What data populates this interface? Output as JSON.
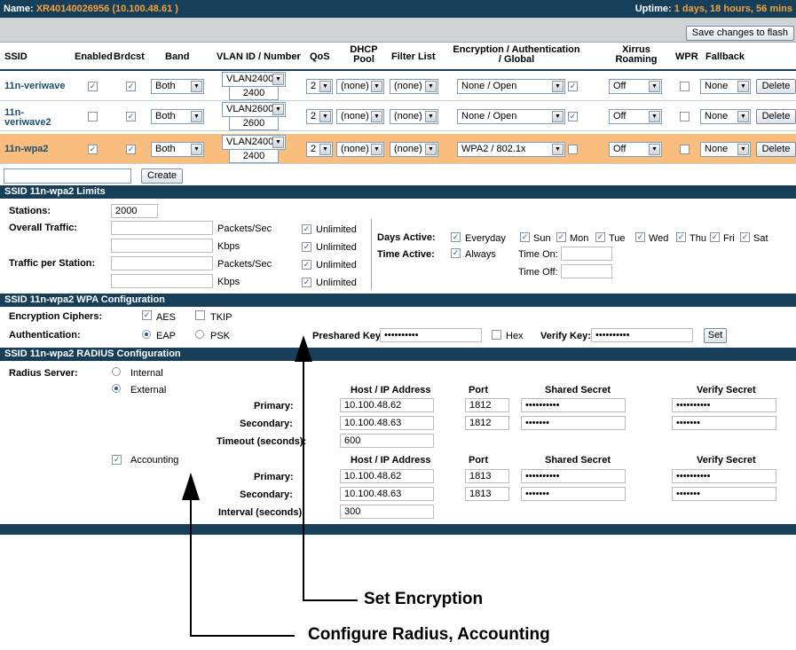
{
  "topbar": {
    "name_label": "Name:",
    "name_value": "XR40140026956   (10.100.48.61 )",
    "uptime_label": "Uptime:",
    "uptime_value": "1 days, 18 hours, 56 mins"
  },
  "save_button": "Save changes to flash",
  "columns": [
    "SSID",
    "Enabled",
    "Brdcst",
    "Band",
    "VLAN ID / Number",
    "QoS",
    "DHCP Pool",
    "Filter List",
    "Encryption / Authentication / Global",
    "Xirrus Roaming",
    "WPR",
    "Fallback"
  ],
  "rows": [
    {
      "ssid": "11n-veriwave",
      "enabled": true,
      "brdcst": true,
      "band": "Both",
      "vlan": "VLAN2400",
      "vlan_num": "2400",
      "qos": "2",
      "dhcp": "(none)",
      "filter": "(none)",
      "enc": "None / Open",
      "global": true,
      "roaming": "Off",
      "wpr": false,
      "fallback": "None",
      "delete": "Delete",
      "selected": false
    },
    {
      "ssid": "11n-veriwave2",
      "enabled": false,
      "brdcst": true,
      "band": "Both",
      "vlan": "VLAN2600",
      "vlan_num": "2600",
      "qos": "2",
      "dhcp": "(none)",
      "filter": "(none)",
      "enc": "None / Open",
      "global": true,
      "roaming": "Off",
      "wpr": false,
      "fallback": "None",
      "delete": "Delete",
      "selected": false
    },
    {
      "ssid": "11n-wpa2",
      "enabled": true,
      "brdcst": true,
      "band": "Both",
      "vlan": "VLAN2400",
      "vlan_num": "2400",
      "qos": "2",
      "dhcp": "(none)",
      "filter": "(none)",
      "enc": "WPA2 / 802.1x",
      "global": false,
      "roaming": "Off",
      "wpr": false,
      "fallback": "None",
      "delete": "Delete",
      "selected": true
    }
  ],
  "create_button": "Create",
  "limits": {
    "title": "SSID 11n-wpa2  Limits",
    "stations_label": "Stations:",
    "stations_value": "2000",
    "overall_label": "Overall Traffic:",
    "per_station_label": "Traffic per Station:",
    "pps": "Packets/Sec",
    "kbps": "Kbps",
    "unlimited": "Unlimited",
    "days_active": "Days Active:",
    "everyday": "Everyday",
    "days": [
      "Sun",
      "Mon",
      "Tue",
      "Wed",
      "Thu",
      "Fri",
      "Sat"
    ],
    "time_active": "Time Active:",
    "always": "Always",
    "time_on": "Time On:",
    "time_off": "Time Off:"
  },
  "wpa": {
    "title": "SSID 11n-wpa2  WPA Configuration",
    "ciphers_label": "Encryption Ciphers:",
    "aes": "AES",
    "tkip": "TKIP",
    "auth_label": "Authentication:",
    "eap": "EAP",
    "psk": "PSK",
    "preshared_label": "Preshared Key:",
    "preshared_value": "••••••••••",
    "hex": "Hex",
    "verify_label": "Verify Key:",
    "verify_value": "••••••••••",
    "set": "Set"
  },
  "radius": {
    "title": "SSID 11n-wpa2  RADIUS Configuration",
    "server_label": "Radius Server:",
    "internal": "Internal",
    "external": "External",
    "host_hdr": "Host / IP Address",
    "port_hdr": "Port",
    "secret_hdr": "Shared Secret",
    "verify_hdr": "Verify Secret",
    "primary": "Primary:",
    "secondary": "Secondary:",
    "timeout_label": "Timeout (seconds):",
    "timeout_value": "600",
    "accounting": "Accounting",
    "interval_label": "Interval (seconds):",
    "interval_value": "300",
    "auth_primary_host": "10.100.48.62",
    "auth_primary_port": "1812",
    "auth_primary_secret": "••••••••••",
    "auth_primary_verify": "••••••••••",
    "auth_secondary_host": "10.100.48.63",
    "auth_secondary_port": "1812",
    "auth_secondary_secret": "•••••••",
    "auth_secondary_verify": "•••••••",
    "acct_primary_host": "10.100.48.62",
    "acct_primary_port": "1813",
    "acct_primary_secret": "••••••••••",
    "acct_primary_verify": "••••••••••",
    "acct_secondary_host": "10.100.48.63",
    "acct_secondary_port": "1813",
    "acct_secondary_secret": "•••••••",
    "acct_secondary_verify": "•••••••"
  },
  "annotations": {
    "set_encryption": "Set Encryption",
    "configure_radius": "Configure Radius, Accounting"
  }
}
